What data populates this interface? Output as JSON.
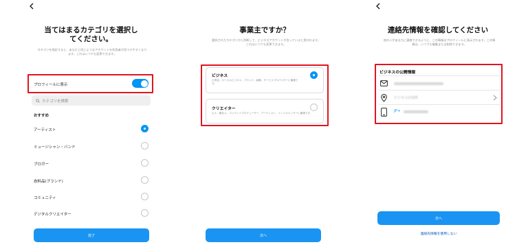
{
  "panel1": {
    "title": "当てはまるカテゴリを選択し\nてください。",
    "subtitle": "カテゴリを指定すると、あなたと同じようなアカウントを利用者が見つけやすくなります。これはいつでも変更できます。",
    "profile_toggle_label": "プロフィールに表示",
    "profile_toggle_on": true,
    "search_placeholder": "カテゴリを検索",
    "section_label": "おすすめ",
    "categories": [
      {
        "label": "アーティスト",
        "selected": true
      },
      {
        "label": "ミュージシャン・バンド",
        "selected": false
      },
      {
        "label": "ブロガー",
        "selected": false
      },
      {
        "label": "衣料品(ブランド)",
        "selected": false
      },
      {
        "label": "コミュニティ",
        "selected": false
      },
      {
        "label": "デジタルクリエイター",
        "selected": false
      }
    ],
    "done_button": "完了"
  },
  "panel2": {
    "title": "事業主ですか？",
    "subtitle": "選択されたカテゴリから判断して、ビジネスアカウントが合っていると思われます。これはいつでも変更できます。",
    "options": [
      {
        "title": "ビジネス",
        "desc": "小売店、ローカルビジネス、ブランド、組織、サービスプロバイダーに最適です。",
        "selected": true
      },
      {
        "title": "クリエイター",
        "desc": "公人・著名人、コンテンツプロデューサー、アーティスト、インフルエンサーに最適です。",
        "selected": false
      }
    ],
    "next_button": "次へ"
  },
  "panel3": {
    "title": "連絡先情報を確認してください",
    "subtitle": "他の人があなたに連絡できるように、この情報はプロフィールに表示されます。この情報は、いつでも編集または削除できます。",
    "section_label": "ビジネスの公開情報",
    "address_placeholder": "ビジネスの住所",
    "phone_prefix": "JP+",
    "next_button": "次へ",
    "no_contact_link": "連絡先情報を使用しない"
  },
  "colors": {
    "accent": "#0095f6",
    "highlight": "#e0141e"
  }
}
